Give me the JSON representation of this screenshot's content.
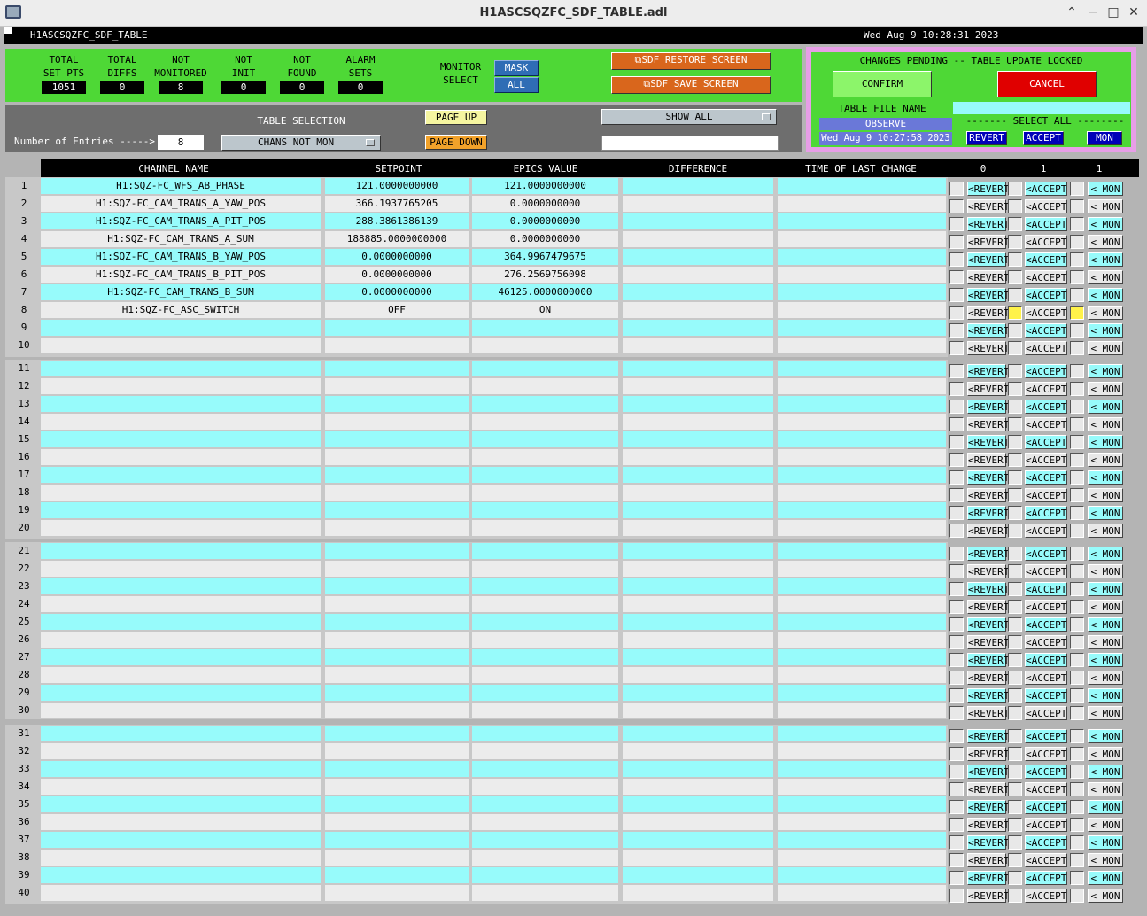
{
  "window": {
    "title": "H1ASCSQZFC_SDF_TABLE.adl"
  },
  "topbar": {
    "name": "H1ASCSQZFC_SDF_TABLE",
    "datetime": "Wed Aug  9 10:28:31 2023"
  },
  "stats": [
    {
      "l1": "TOTAL",
      "l2": "SET PTS",
      "value": "1051"
    },
    {
      "l1": "TOTAL",
      "l2": "DIFFS",
      "value": "0"
    },
    {
      "l1": "NOT",
      "l2": "MONITORED",
      "value": "8"
    },
    {
      "l1": "NOT",
      "l2": "INIT",
      "value": "0"
    },
    {
      "l1": "NOT",
      "l2": "FOUND",
      "value": "0"
    },
    {
      "l1": "ALARM",
      "l2": "SETS",
      "value": "0"
    }
  ],
  "monitor": {
    "l1": "MONITOR",
    "l2": "SELECT",
    "mask": "MASK",
    "all": "ALL"
  },
  "buttons": {
    "restore": "⧉SDF RESTORE SCREEN",
    "save": "⧉SDF SAVE SCREEN"
  },
  "pending": {
    "title": "CHANGES PENDING -- TABLE UPDATE LOCKED",
    "confirm": "CONFIRM",
    "cancel": "CANCEL",
    "file_label": "TABLE FILE NAME",
    "file_value": "OBSERVE",
    "file_time": "Wed Aug  9 10:27:58 2023",
    "select_all": "------- SELECT ALL --------",
    "revert": "REVERT",
    "accept": "ACCEPT",
    "mon": "MON"
  },
  "selection": {
    "label": "TABLE SELECTION",
    "value": "CHANS NOT MON",
    "entries_label": "Number of Entries ----->",
    "entries": "8",
    "page_up": "PAGE UP",
    "page_down": "PAGE DOWN",
    "show": "SHOW ALL"
  },
  "columns": {
    "name": "CHANNEL NAME",
    "setpoint": "SETPOINT",
    "epics": "EPICS VALUE",
    "diff": "DIFFERENCE",
    "time": "TIME OF LAST CHANGE",
    "c0": "0",
    "c1": "1",
    "c2": "1"
  },
  "row_buttons": {
    "revert": "<REVERT",
    "accept": "<ACCEPT",
    "mon": "< MON"
  },
  "rows": [
    {
      "n": "1",
      "name": "H1:SQZ-FC_WFS_AB_PHASE",
      "sp": "121.0000000000",
      "ev": "121.0000000000"
    },
    {
      "n": "2",
      "name": "H1:SQZ-FC_CAM_TRANS_A_YAW_POS",
      "sp": "366.1937765205",
      "ev": "0.0000000000"
    },
    {
      "n": "3",
      "name": "H1:SQZ-FC_CAM_TRANS_A_PIT_POS",
      "sp": "288.3861386139",
      "ev": "0.0000000000"
    },
    {
      "n": "4",
      "name": "H1:SQZ-FC_CAM_TRANS_A_SUM",
      "sp": "188885.0000000000",
      "ev": "0.0000000000"
    },
    {
      "n": "5",
      "name": "H1:SQZ-FC_CAM_TRANS_B_YAW_POS",
      "sp": "0.0000000000",
      "ev": "364.9967479675"
    },
    {
      "n": "6",
      "name": "H1:SQZ-FC_CAM_TRANS_B_PIT_POS",
      "sp": "0.0000000000",
      "ev": "276.2569756098"
    },
    {
      "n": "7",
      "name": "H1:SQZ-FC_CAM_TRANS_B_SUM",
      "sp": "0.0000000000",
      "ev": "46125.0000000000"
    },
    {
      "n": "8",
      "name": "H1:SQZ-FC_ASC_SWITCH",
      "sp": "OFF",
      "ev": "ON"
    },
    {
      "n": "9"
    },
    {
      "n": "10"
    },
    {
      "n": "11"
    },
    {
      "n": "12"
    },
    {
      "n": "13"
    },
    {
      "n": "14"
    },
    {
      "n": "15"
    },
    {
      "n": "16"
    },
    {
      "n": "17"
    },
    {
      "n": "18"
    },
    {
      "n": "19"
    },
    {
      "n": "20"
    },
    {
      "n": "21"
    },
    {
      "n": "22"
    },
    {
      "n": "23"
    },
    {
      "n": "24"
    },
    {
      "n": "25"
    },
    {
      "n": "26"
    },
    {
      "n": "27"
    },
    {
      "n": "28"
    },
    {
      "n": "29"
    },
    {
      "n": "30"
    },
    {
      "n": "31"
    },
    {
      "n": "32"
    },
    {
      "n": "33"
    },
    {
      "n": "34"
    },
    {
      "n": "35"
    },
    {
      "n": "36"
    },
    {
      "n": "37"
    },
    {
      "n": "38"
    },
    {
      "n": "39"
    },
    {
      "n": "40"
    }
  ]
}
